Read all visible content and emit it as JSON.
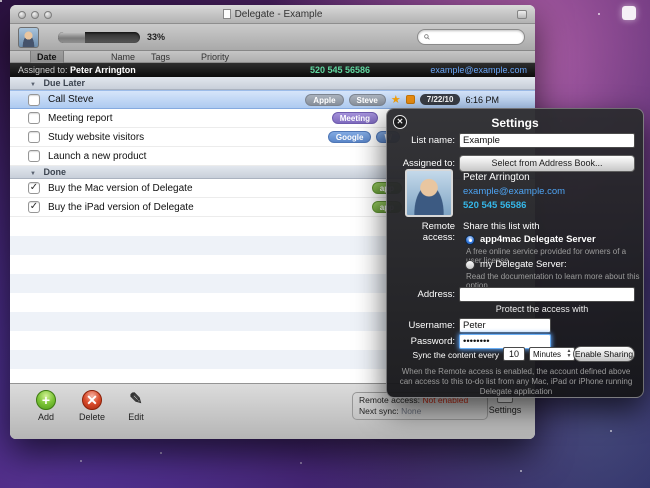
{
  "icons": {
    "check": "✓",
    "star": "★",
    "close": "✕",
    "plus": "+",
    "cross": "✕",
    "pencil": "✎",
    "triangle": "▼",
    "up": "▲",
    "down": "▼"
  },
  "window": {
    "title": "Delegate - Example",
    "progress": {
      "percent": 33,
      "label": "33%"
    },
    "search": {
      "placeholder": ""
    },
    "tabs": [
      {
        "label": "Date"
      },
      {
        "label": "Name"
      },
      {
        "label": "Tags"
      },
      {
        "label": "Priority"
      }
    ],
    "assigned_bar": {
      "prefix": "Assigned to:",
      "name": "Peter Arrington",
      "phone": "520 545 56586",
      "email": "example@example.com"
    },
    "sections": [
      {
        "title": "Due Later",
        "rows": [
          {
            "title": "Call Steve",
            "checked": false,
            "selected": true,
            "tags": [
              {
                "label": "Apple",
                "color": "#98a0ab"
              },
              {
                "label": "Steve",
                "color": "#98a0ab"
              }
            ],
            "flagged": true,
            "priority_color": "#ed8f12",
            "date": "7/22/10",
            "time": "6:16 PM"
          },
          {
            "title": "Meeting report",
            "checked": false,
            "tags": [
              {
                "label": "Meeting",
                "color": "#8f7bc8"
              }
            ]
          },
          {
            "title": "Study website visitors",
            "checked": false,
            "tags": [
              {
                "label": "Google",
                "color": "#5f95d6"
              },
              {
                "label": "W",
                "color": "#5f95d6"
              }
            ]
          },
          {
            "title": "Launch a new product",
            "checked": false,
            "tags": []
          }
        ]
      },
      {
        "title": "Done",
        "rows": [
          {
            "title": "Buy the Mac version of Delegate",
            "checked": true,
            "tags": [
              {
                "label": "app",
                "color": "#7ab648"
              }
            ]
          },
          {
            "title": "Buy the iPad version of Delegate",
            "checked": true,
            "tags": [
              {
                "label": "app",
                "color": "#7ab648"
              }
            ]
          }
        ]
      }
    ],
    "bottom_bar": {
      "add_label": "Add",
      "delete_label": "Delete",
      "edit_label": "Edit",
      "settings_label": "Settings",
      "remote_access_label": "Remote access:",
      "remote_access_value": "Not enabled",
      "remote_access_value_color": "#cc2a12",
      "next_sync_label": "Next sync:",
      "next_sync_value": "None"
    }
  },
  "settings_panel": {
    "title": "Settings",
    "list_name_label": "List name:",
    "list_name_value": "Example",
    "assigned_to_label": "Assigned to:",
    "address_book_button": "Select from Address Book...",
    "contact": {
      "name": "Peter Arrington",
      "email": "example@example.com",
      "phone": "520 545 56586"
    },
    "remote_access_label": "Remote access:",
    "share_with_label": "Share this list with",
    "options": [
      {
        "label": "app4mac Delegate Server",
        "desc": "A free online service provided for owners of a user license",
        "selected": true
      },
      {
        "label": "my Delegate Server:",
        "desc": "Read the documentation to learn more about this option",
        "selected": false
      }
    ],
    "address_label": "Address:",
    "address_value": "",
    "protect_label": "Protect the access with",
    "username_label": "Username:",
    "username_value": "Peter",
    "password_label": "Password:",
    "password_value": "••••••••",
    "sync_label": "Sync the content every",
    "sync_value": "10",
    "sync_unit": "Minutes",
    "enable_sharing_button": "Enable Sharing",
    "footer_note": "When the Remote access is enabled, the account defined above can access to this to-do list from any Mac, iPad or iPhone running Delegate application"
  }
}
